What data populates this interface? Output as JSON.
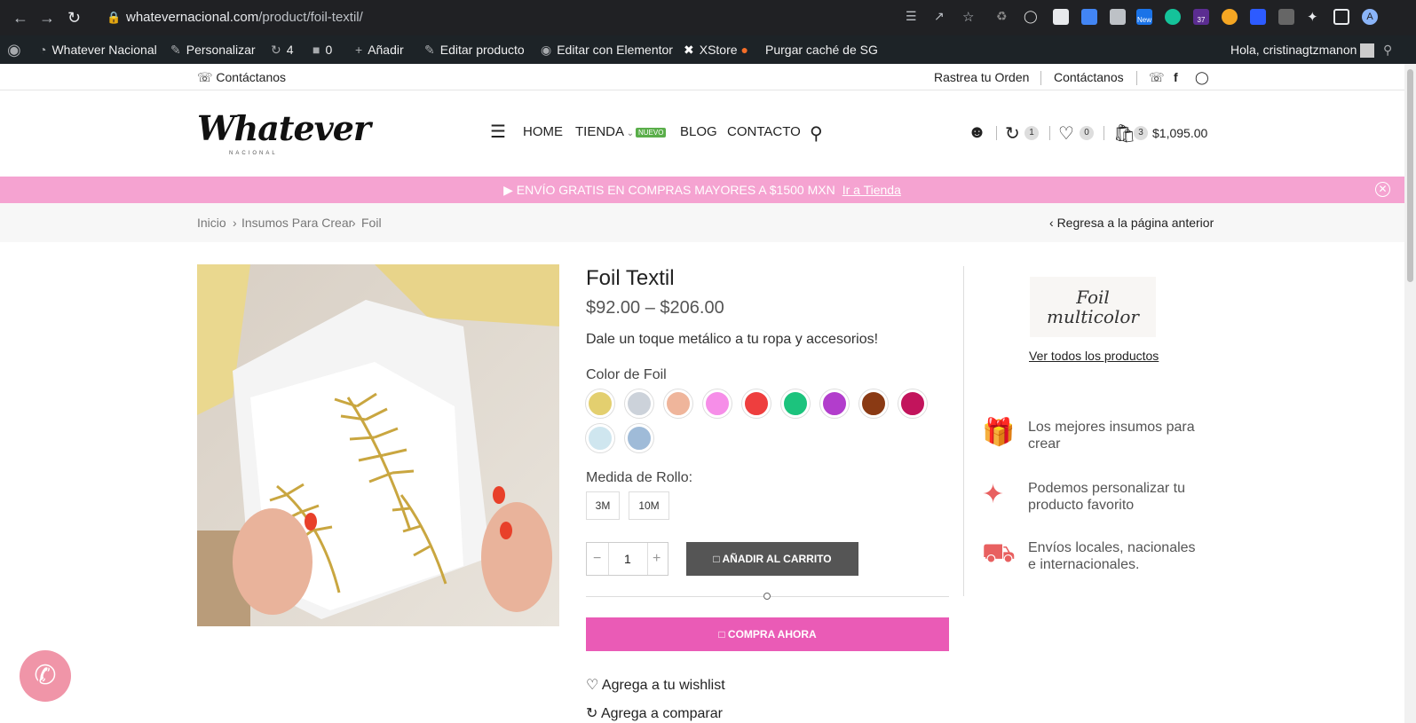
{
  "browser": {
    "url_host": "whatevernacional.com",
    "url_path": "/product/foil-textil/",
    "ext_badge_new": "New",
    "ext_badge_37": "37"
  },
  "wpbar": {
    "site": "Whatever Nacional",
    "customize": "Personalizar",
    "updates": "4",
    "comments": "0",
    "add": "Añadir",
    "edit_product": "Editar producto",
    "elementor": "Editar con Elementor",
    "xstore": "XStore",
    "purge": "Purgar caché de SG",
    "greeting": "Hola, cristinagtzmanon"
  },
  "topbar": {
    "contact_left": "Contáctanos",
    "track": "Rastrea tu Orden",
    "contact_right": "Contáctanos"
  },
  "header": {
    "logo": "Whatever",
    "logo_sub": "NACIONAL",
    "menu": [
      "HOME",
      "TIENDA",
      "BLOG",
      "CONTACTO"
    ],
    "new_badge": "NUEVO",
    "compare_count": "1",
    "wishlist_count": "0",
    "cart_count": "3",
    "cart_total": "$1,095.00"
  },
  "promo": {
    "text": "ENVÍO GRATIS EN COMPRAS MAYORES A $1500 MXN",
    "link": "Ir a Tienda"
  },
  "breadcrumb": {
    "items": [
      "Inicio",
      "Insumos Para Crear",
      "Foil"
    ],
    "back": "Regresa a la página anterior"
  },
  "product": {
    "title": "Foil Textil",
    "price": "$92.00 – $206.00",
    "short": "Dale un toque metálico a tu ropa y accesorios!",
    "color_label": "Color de Foil",
    "colors": [
      "#e3cf6f",
      "#ccd2da",
      "#efb59b",
      "#f68ee8",
      "#ee3e3e",
      "#1cc37d",
      "#b23dcc",
      "#8a3a14",
      "#c2145c",
      "#cfe6ef",
      "#9fbbd8"
    ],
    "size_label": "Medida de Rollo:",
    "sizes": [
      "3M",
      "10M"
    ],
    "qty": "1",
    "add_to_cart": "AÑADIR AL CARRITO",
    "buy_now": "COMPRA AHORA",
    "wishlist": "Agrega a tu wishlist",
    "compare": "Agrega a comparar"
  },
  "sidebar": {
    "brand_line1": "Foil",
    "brand_line2": "multicolor",
    "view_all": "Ver todos los productos",
    "features": [
      "Los mejores insumos para crear",
      "Podemos personalizar tu producto favorito",
      "Envíos locales, nacionales e internacionales."
    ]
  }
}
